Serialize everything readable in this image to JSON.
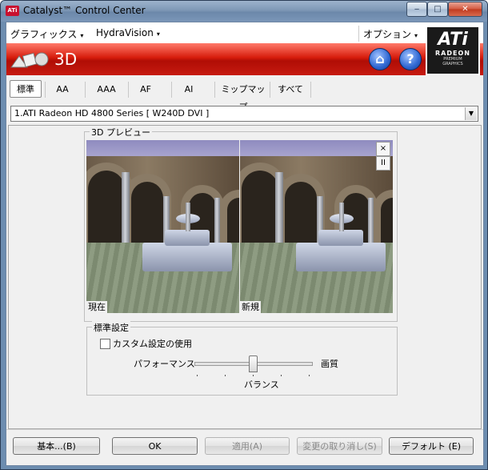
{
  "window": {
    "title": "Catalyst™ Control Center",
    "badge": "ATi",
    "controls": {
      "minimize": "‒",
      "maximize": "□",
      "close": "✕"
    }
  },
  "menu": {
    "graphics": "グラフィックス",
    "hydravision": "HydraVision",
    "options": "オプション",
    "caret": "▾"
  },
  "banner": {
    "title": "3D",
    "accent": "#c8102e",
    "home_icon": "⌂",
    "help_icon": "?"
  },
  "logo": {
    "ati": "ATi",
    "radeon": "RADEON",
    "premium": "PREMIUM",
    "graphics": "GRAPHICS"
  },
  "tabs": [
    {
      "label": "標準"
    },
    {
      "label": "AA"
    },
    {
      "label": "AAA"
    },
    {
      "label": "AF"
    },
    {
      "label": "AI"
    },
    {
      "label": "ミップマップ"
    },
    {
      "label": "すべて"
    }
  ],
  "device": {
    "selected": "1.ATI Radeon HD 4800 Series  [ W240D DVI ]",
    "arrow": "▼"
  },
  "preview": {
    "legend": "3D プレビュー",
    "left_label": "現在",
    "right_label": "新規",
    "close_btn": "×",
    "pause_btn": "II"
  },
  "standard": {
    "legend": "標準設定",
    "custom_checkbox": "カスタム設定の使用",
    "custom_checked": false,
    "left_label": "パフォーマンス",
    "right_label": "画質",
    "center_label": "バランス",
    "slider_value": 0.5,
    "slider_steps": 5
  },
  "buttons": {
    "basic": "基本...(B)",
    "ok": "OK",
    "apply": "適用(A)",
    "discard": "変更の取り消し(S)",
    "defaults": "デフォルト (E)"
  }
}
